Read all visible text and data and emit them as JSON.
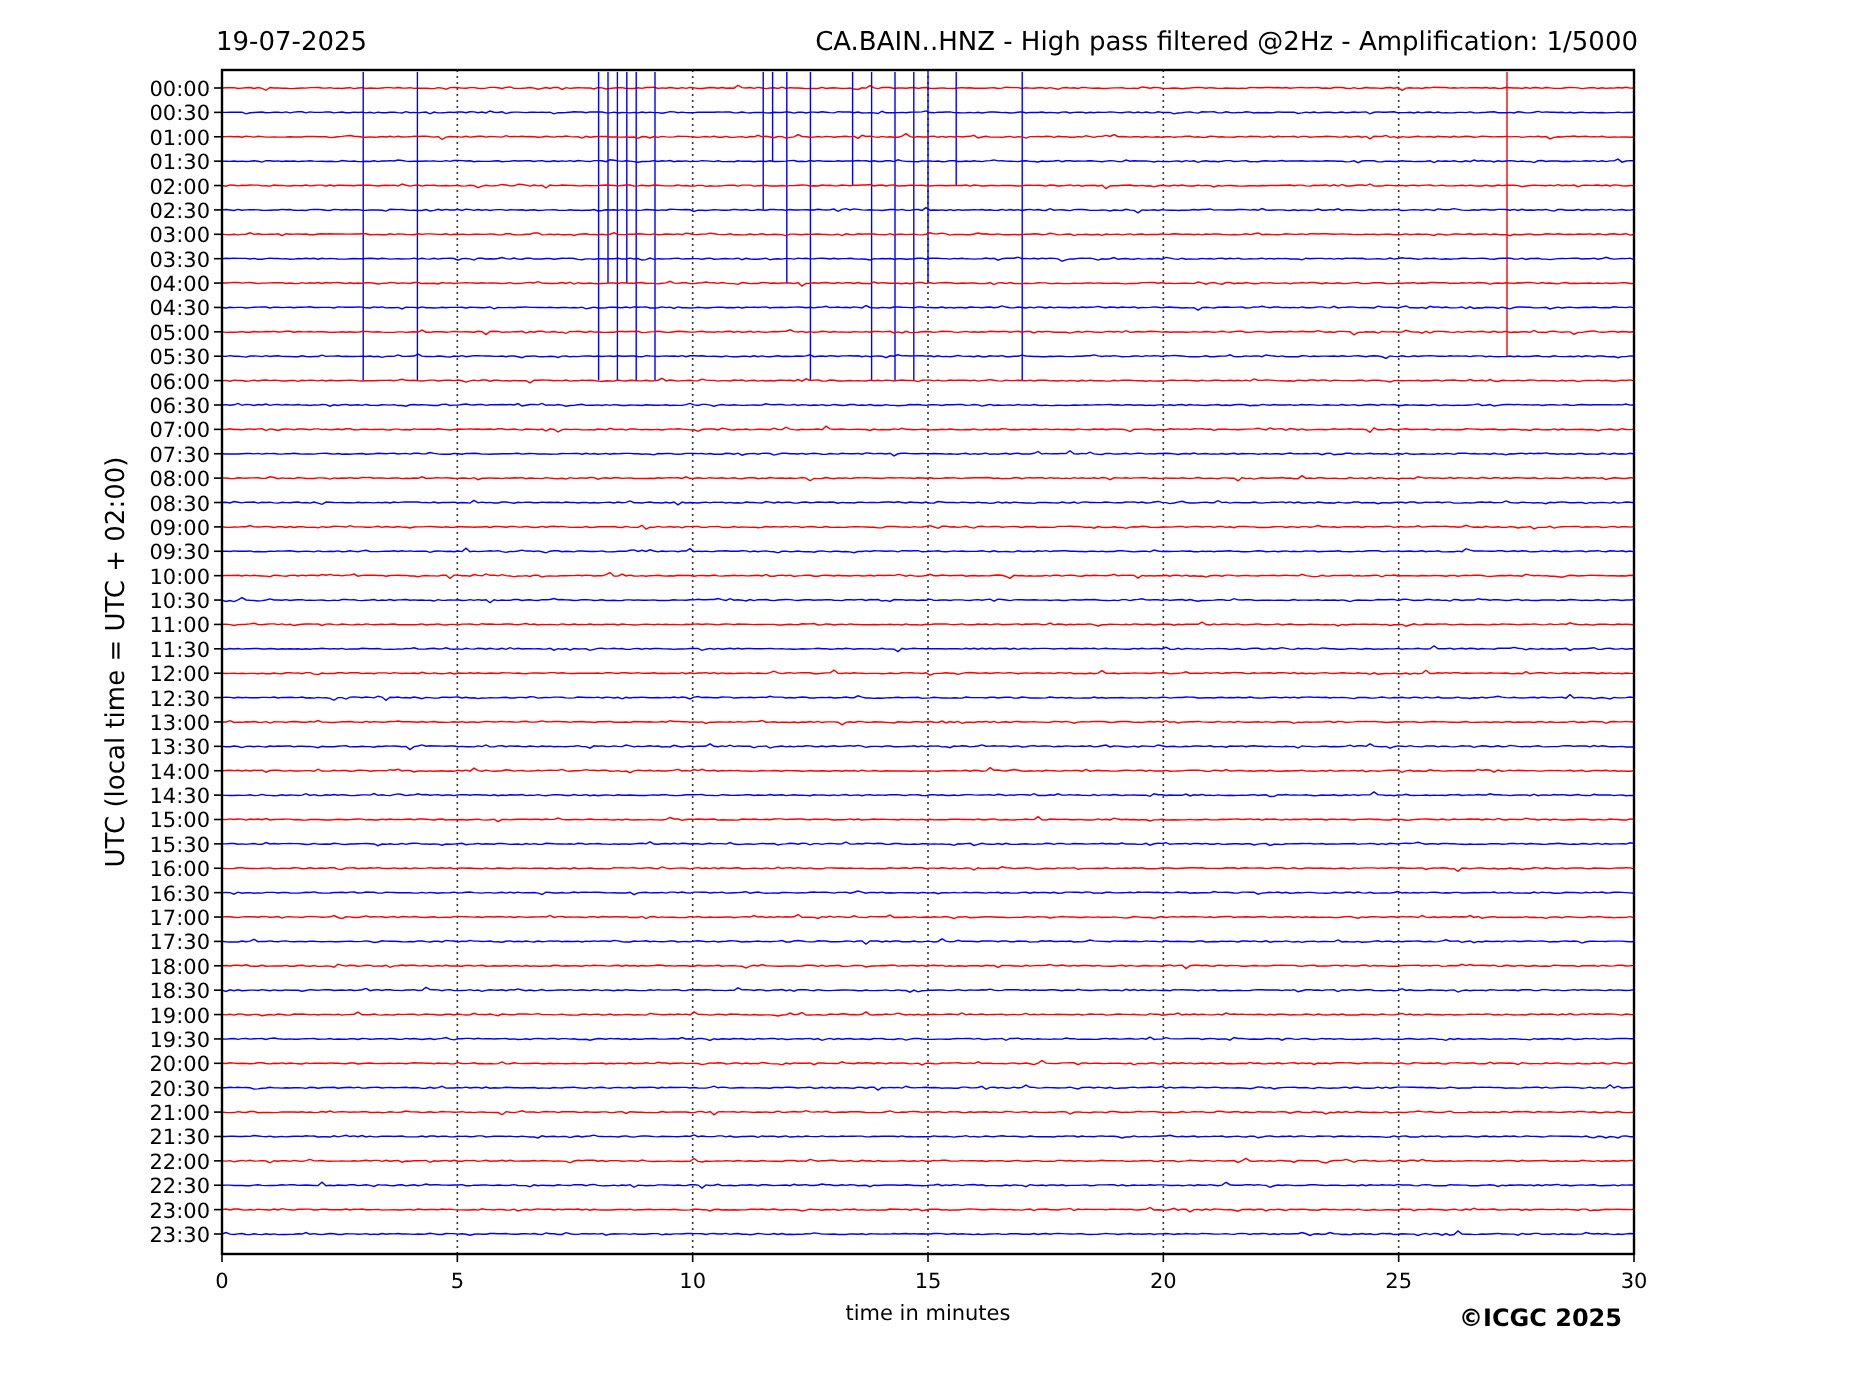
{
  "date": "19-07-2025",
  "title": "CA.BAIN..HNZ - High pass filtered @2Hz - Amplification: 1/5000",
  "ylabel": "UTC (local time = UTC + 02:00)",
  "xlabel": "time in minutes",
  "xticks": [
    "0",
    "5",
    "10",
    "15",
    "20",
    "25",
    "30"
  ],
  "rows": [
    {
      "time": "00:00",
      "color": "#ff0000"
    },
    {
      "time": "00:30",
      "color": "#0000ff"
    },
    {
      "time": "01:00",
      "color": "#ff0000"
    },
    {
      "time": "01:30",
      "color": "#0000ff"
    },
    {
      "time": "02:00",
      "color": "#ff0000"
    },
    {
      "time": "02:30",
      "color": "#0000ff"
    },
    {
      "time": "03:00",
      "color": "#ff0000"
    },
    {
      "time": "03:30",
      "color": "#0000ff"
    },
    {
      "time": "04:00",
      "color": "#ff0000"
    },
    {
      "time": "04:30",
      "color": "#0000ff"
    },
    {
      "time": "05:00",
      "color": "#ff0000"
    },
    {
      "time": "05:30",
      "color": "#0000ff"
    },
    {
      "time": "06:00",
      "color": "#ff0000"
    },
    {
      "time": "06:30",
      "color": "#0000ff"
    },
    {
      "time": "07:00",
      "color": "#ff0000"
    },
    {
      "time": "07:30",
      "color": "#0000ff"
    },
    {
      "time": "08:00",
      "color": "#ff0000"
    },
    {
      "time": "08:30",
      "color": "#0000ff"
    },
    {
      "time": "09:00",
      "color": "#ff0000"
    },
    {
      "time": "09:30",
      "color": "#0000ff"
    },
    {
      "time": "10:00",
      "color": "#ff0000"
    },
    {
      "time": "10:30",
      "color": "#0000ff"
    },
    {
      "time": "11:00",
      "color": "#ff0000"
    },
    {
      "time": "11:30",
      "color": "#0000ff"
    },
    {
      "time": "12:00",
      "color": "#ff0000"
    },
    {
      "time": "12:30",
      "color": "#0000ff"
    },
    {
      "time": "13:00",
      "color": "#ff0000"
    },
    {
      "time": "13:30",
      "color": "#0000ff"
    },
    {
      "time": "14:00",
      "color": "#ff0000"
    },
    {
      "time": "14:30",
      "color": "#0000ff"
    },
    {
      "time": "15:00",
      "color": "#ff0000"
    },
    {
      "time": "15:30",
      "color": "#0000ff"
    },
    {
      "time": "16:00",
      "color": "#ff0000"
    },
    {
      "time": "16:30",
      "color": "#0000ff"
    },
    {
      "time": "17:00",
      "color": "#ff0000"
    },
    {
      "time": "17:30",
      "color": "#0000ff"
    },
    {
      "time": "18:00",
      "color": "#ff0000"
    },
    {
      "time": "18:30",
      "color": "#0000ff"
    },
    {
      "time": "19:00",
      "color": "#ff0000"
    },
    {
      "time": "19:30",
      "color": "#0000ff"
    },
    {
      "time": "20:00",
      "color": "#ff0000"
    },
    {
      "time": "20:30",
      "color": "#0000ff"
    },
    {
      "time": "21:00",
      "color": "#ff0000"
    },
    {
      "time": "21:30",
      "color": "#0000ff"
    },
    {
      "time": "22:00",
      "color": "#ff0000"
    },
    {
      "time": "22:30",
      "color": "#0000ff"
    },
    {
      "time": "23:00",
      "color": "#ff0000"
    },
    {
      "time": "23:30",
      "color": "#0000ff"
    }
  ],
  "copyright": "©ICGC 2025"
}
